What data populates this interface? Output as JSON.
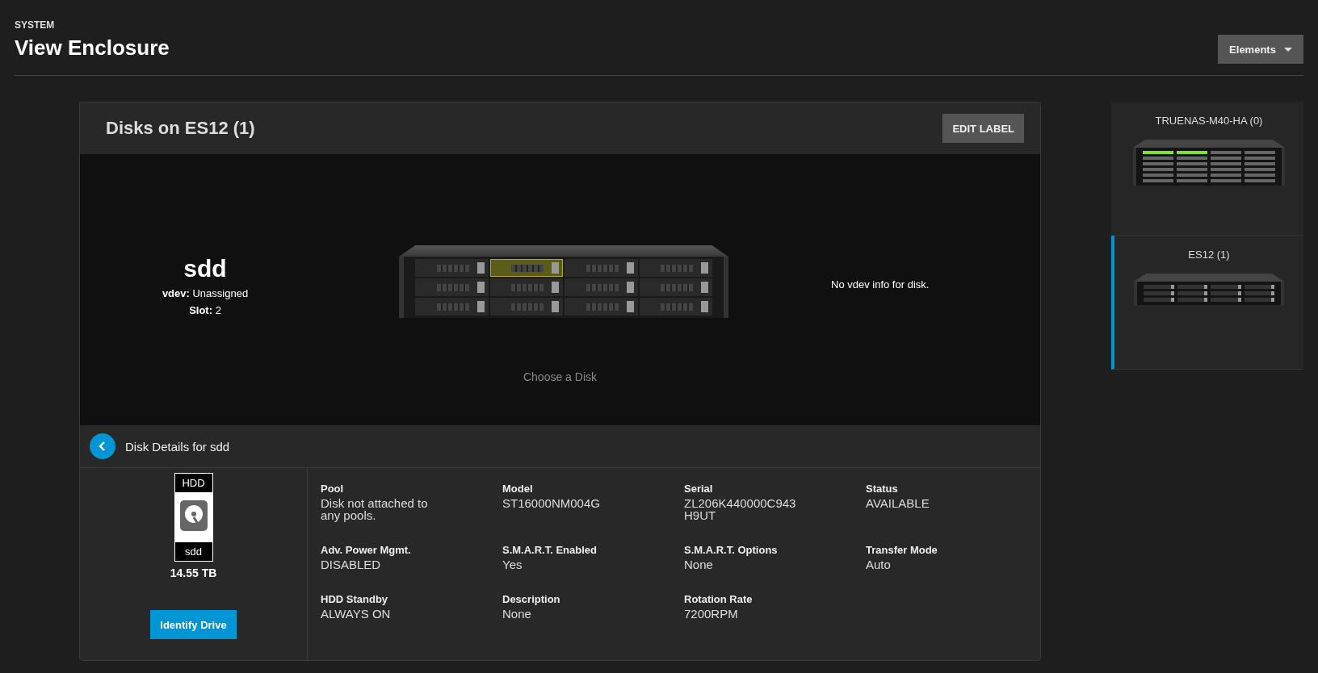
{
  "header": {
    "section": "SYSTEM",
    "title": "View Enclosure",
    "elements_button": "Elements"
  },
  "card": {
    "title": "Disks on ES12 (1)",
    "edit_button": "EDIT LABEL"
  },
  "disk_summary": {
    "name": "sdd",
    "vdev_label": "vdev:",
    "vdev_value": "Unassigned",
    "slot_label": "Slot:",
    "slot_value": "2"
  },
  "slots": [
    {
      "selected": false
    },
    {
      "selected": true
    },
    {
      "selected": false
    },
    {
      "selected": false
    },
    {
      "selected": false
    },
    {
      "selected": false
    },
    {
      "selected": false
    },
    {
      "selected": false
    },
    {
      "selected": false
    },
    {
      "selected": false
    },
    {
      "selected": false
    },
    {
      "selected": false
    }
  ],
  "vdev_info": "No vdev info for disk.",
  "hint": "Choose a Disk",
  "details": {
    "title": "Disk Details for sdd",
    "disk_type": "HDD",
    "disk_name": "sdd",
    "size": "14.55 TB",
    "identify_button": "Identify Drive",
    "fields": [
      {
        "label": "Pool",
        "value": "Disk not attached to any pools."
      },
      {
        "label": "Model",
        "value": "ST16000NM004G"
      },
      {
        "label": "Serial",
        "value": "ZL206K440000C943H9UT"
      },
      {
        "label": "Status",
        "value": "AVAILABLE"
      },
      {
        "label": "Adv. Power Mgmt.",
        "value": "DISABLED"
      },
      {
        "label": "S.M.A.R.T. Enabled",
        "value": "Yes"
      },
      {
        "label": "S.M.A.R.T. Options",
        "value": "None"
      },
      {
        "label": "Transfer Mode",
        "value": "Auto"
      },
      {
        "label": "HDD Standby",
        "value": "ALWAYS ON"
      },
      {
        "label": "Description",
        "value": "None"
      },
      {
        "label": "Rotation Rate",
        "value": "7200RPM"
      }
    ]
  },
  "enclosures": [
    {
      "label": "TRUENAS-M40-HA (0)",
      "kind": "large",
      "selected": false
    },
    {
      "label": "ES12 (1)",
      "kind": "small",
      "selected": true
    }
  ]
}
